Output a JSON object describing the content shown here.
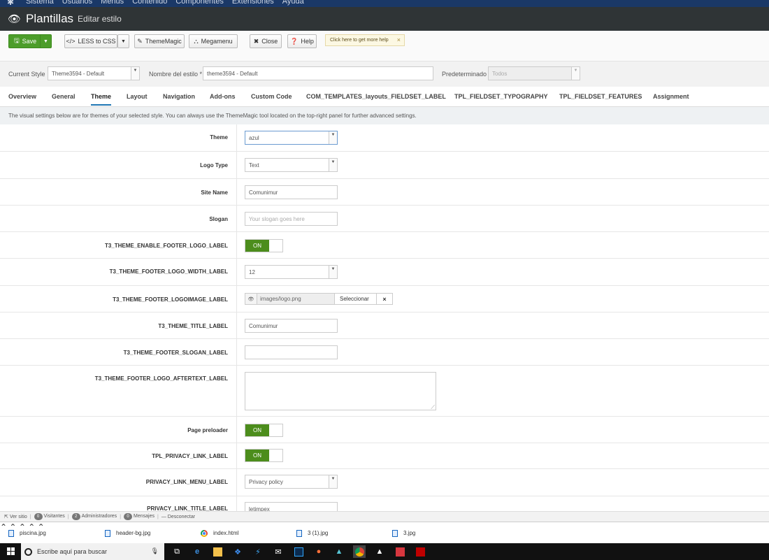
{
  "topmenu": {
    "items": [
      "Sistema",
      "Usuarios",
      "Menús",
      "Contenido",
      "Componentes",
      "Extensiones",
      "Ayuda"
    ]
  },
  "header": {
    "title": "Plantillas",
    "subtitle": "Editar estilo"
  },
  "toolbar": {
    "save": "Save",
    "less": "LESS to CSS",
    "thememagic": "ThemeMagic",
    "megamenu": "Megamenu",
    "close": "Close",
    "help": "Help",
    "hint": "Click here to get more help"
  },
  "style": {
    "current_label": "Current Style",
    "current_value": "Theme3594 - Default",
    "name_label": "Nombre del estilo *",
    "name_value": "theme3594 - Default",
    "default_label": "Predeterminado",
    "default_value": "Todos"
  },
  "tabs": [
    "Overview",
    "General",
    "Theme",
    "Layout",
    "Navigation",
    "Add-ons",
    "Custom Code",
    "COM_TEMPLATES_layouts_FIELDSET_LABEL",
    "TPL_FIELDSET_TYPOGRAPHY",
    "TPL_FIELDSET_FEATURES",
    "Assignment"
  ],
  "active_tab": "Theme",
  "intro": "The visual settings below are for themes of your selected style. You can always use the ThemeMagic tool located on the top-right panel for further advanced settings.",
  "fields": {
    "theme": {
      "label": "Theme",
      "value": "azul"
    },
    "logo_type": {
      "label": "Logo Type",
      "value": "Text"
    },
    "site_name": {
      "label": "Site Name",
      "value": "Comunimur"
    },
    "slogan": {
      "label": "Slogan",
      "placeholder": "Your slogan goes here"
    },
    "footer_logo_enable": {
      "label": "T3_THEME_ENABLE_FOOTER_LOGO_LABEL",
      "value": "ON"
    },
    "footer_logo_width": {
      "label": "T3_THEME_FOOTER_LOGO_WIDTH_LABEL",
      "value": "12"
    },
    "footer_logo_image": {
      "label": "T3_THEME_FOOTER_LOGOIMAGE_LABEL",
      "value": "images/logo.png",
      "select": "Seleccionar"
    },
    "title": {
      "label": "T3_THEME_TITLE_LABEL",
      "value": "Comunimur"
    },
    "footer_slogan": {
      "label": "T3_THEME_FOOTER_SLOGAN_LABEL",
      "value": ""
    },
    "footer_aftertext": {
      "label": "T3_THEME_FOOTER_LOGO_AFTERTEXT_LABEL",
      "value": ""
    },
    "preloader": {
      "label": "Page preloader",
      "value": "ON"
    },
    "privacy_link": {
      "label": "TPL_PRIVACY_LINK_LABEL",
      "value": "ON"
    },
    "privacy_menu": {
      "label": "PRIVACY_LINK_MENU_LABEL",
      "value": "Privacy policy"
    },
    "privacy_title": {
      "label": "PRIVACY_LINK_TITLE_LABEL",
      "value": "letimpex"
    }
  },
  "statusbar": {
    "view_site": "Ver sitio",
    "visitors_count": "0",
    "visitors": "Visitantes",
    "admins_count": "2",
    "admins": "Administradores",
    "messages_count": "0",
    "messages": "Mensajes",
    "logout": "Desconectar"
  },
  "downloads": [
    "piscina.jpg",
    "header-bg.jpg",
    "index.html",
    "3 (1).jpg",
    "3.jpg"
  ],
  "taskbar": {
    "search_placeholder": "Escribe aquí para buscar"
  },
  "colors": {
    "save_green": "#4c9d2a",
    "toggle_green": "#4c8d1c",
    "titlebar": "#2f3436",
    "topmenu": "#1a3867",
    "tab_underline": "#1f77b4"
  }
}
